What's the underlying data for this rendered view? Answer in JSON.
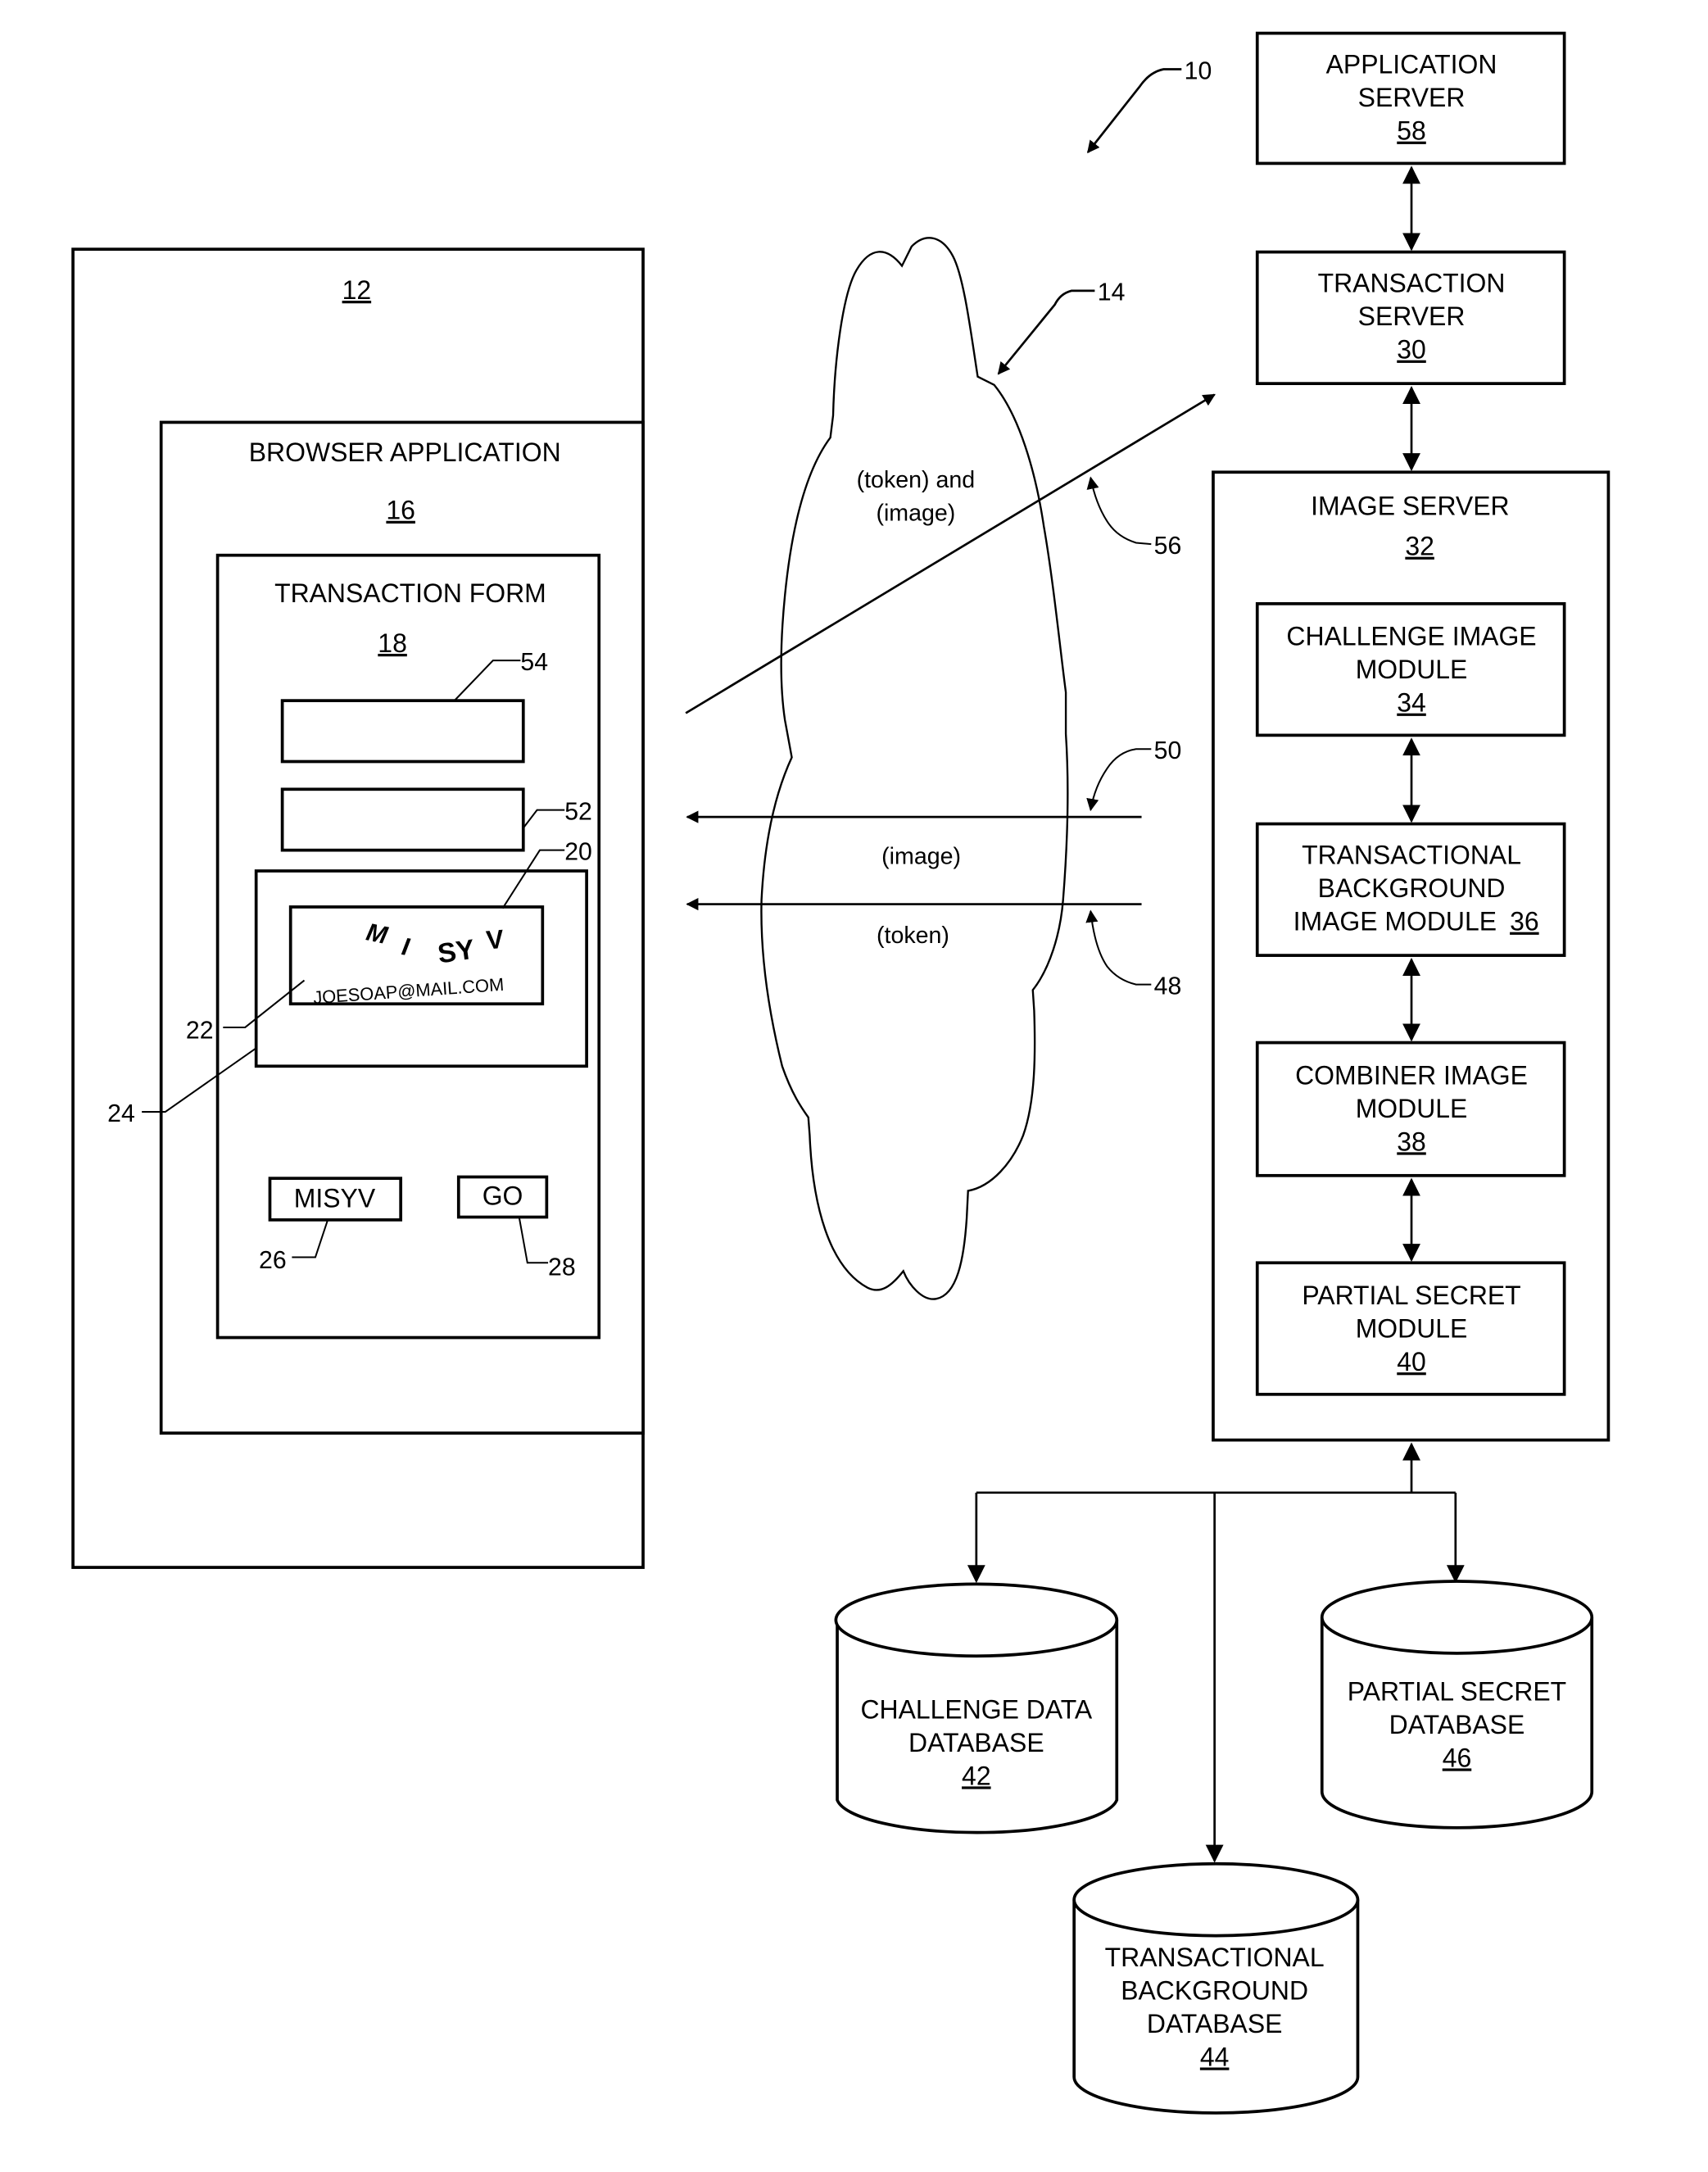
{
  "figure_ref": "10",
  "client_device": {
    "ref": "12"
  },
  "browser": {
    "title": "BROWSER APPLICATION",
    "ref": "16"
  },
  "form": {
    "title": "TRANSACTION FORM",
    "ref": "18",
    "field_top_ref": "54",
    "field_second_ref": "52",
    "challenge_container_ref": "24",
    "challenge_image_ref": "20",
    "challenge_text_ref": "22",
    "captcha_chars": [
      "M",
      "I",
      "SY",
      "V"
    ],
    "captcha_email": "JOESOAP@MAIL.COM",
    "answer_field": {
      "value": "MISYV",
      "ref": "26"
    },
    "go_button": {
      "label": "GO",
      "ref": "28"
    }
  },
  "network": {
    "ref": "14",
    "messages": [
      {
        "text_line1": "(token) and",
        "text_line2": "(image)",
        "ref": "56"
      },
      {
        "text": "(image)",
        "ref": "50"
      },
      {
        "text": "(token)",
        "ref": "48"
      }
    ]
  },
  "servers": {
    "application": {
      "line1": "APPLICATION",
      "line2": "SERVER",
      "ref": "58"
    },
    "transaction": {
      "line1": "TRANSACTION",
      "line2": "SERVER",
      "ref": "30"
    },
    "image": {
      "line1": "IMAGE SERVER",
      "ref": "32"
    }
  },
  "modules": [
    {
      "line1": "CHALLENGE IMAGE",
      "line2": "MODULE",
      "ref": "34"
    },
    {
      "line1": "TRANSACTIONAL",
      "line2": "BACKGROUND",
      "line3": "IMAGE MODULE",
      "ref": "36"
    },
    {
      "line1": "COMBINER IMAGE",
      "line2": "MODULE",
      "ref": "38"
    },
    {
      "line1": "PARTIAL SECRET",
      "line2": "MODULE",
      "ref": "40"
    }
  ],
  "databases": [
    {
      "line1": "CHALLENGE DATA",
      "line2": "DATABASE",
      "ref": "42"
    },
    {
      "line1": "TRANSACTIONAL",
      "line2": "BACKGROUND",
      "line3": "DATABASE",
      "ref": "44"
    },
    {
      "line1": "PARTIAL SECRET",
      "line2": "DATABASE",
      "ref": "46"
    }
  ]
}
